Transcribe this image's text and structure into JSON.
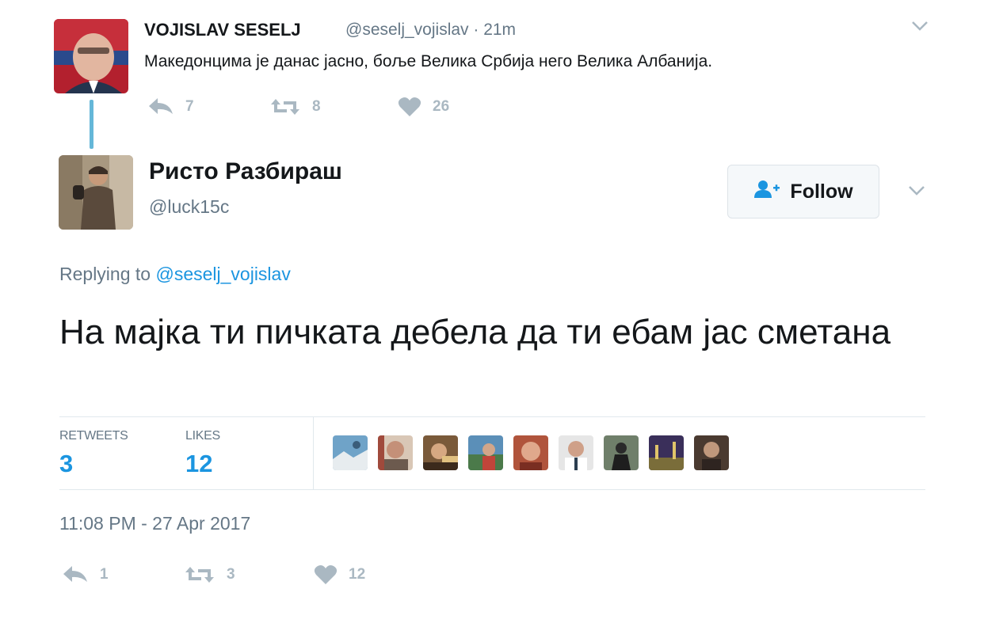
{
  "parent_tweet": {
    "author_name": "VOJISLAV SESELJ",
    "handle_time": "@seselj_vojislav · 21m",
    "text": "Македонцима је данас јасно, боље Велика Србија него Велика Албанија.",
    "actions": {
      "reply_count": "7",
      "retweet_count": "8",
      "like_count": "26"
    },
    "avatar_icon": "avatar-photo"
  },
  "reply_tweet": {
    "author_name": "Ристо Разбираш",
    "handle": "@luck15c",
    "follow_label": "Follow",
    "replying_prefix": "Replying to",
    "replying_handle": "@seselj_vojislav",
    "text": "На мајка ти пичката дебела да ти ебам јас сметана",
    "stats": {
      "retweets_label": "RETWEETS",
      "retweets_value": "3",
      "likes_label": "LIKES",
      "likes_value": "12"
    },
    "liker_avatars": [
      "liker-1",
      "liker-2",
      "liker-3",
      "liker-4",
      "liker-5",
      "liker-6",
      "liker-7",
      "liker-8",
      "liker-9"
    ],
    "timestamp": "11:08 PM - 27 Apr 2017",
    "actions": {
      "reply_count": "1",
      "retweet_count": "3",
      "like_count": "12"
    }
  },
  "colors": {
    "link_blue": "#1b95e0",
    "thread_line": "#65b7d8",
    "muted": "#aab8c2",
    "secondary_text": "#657786"
  }
}
